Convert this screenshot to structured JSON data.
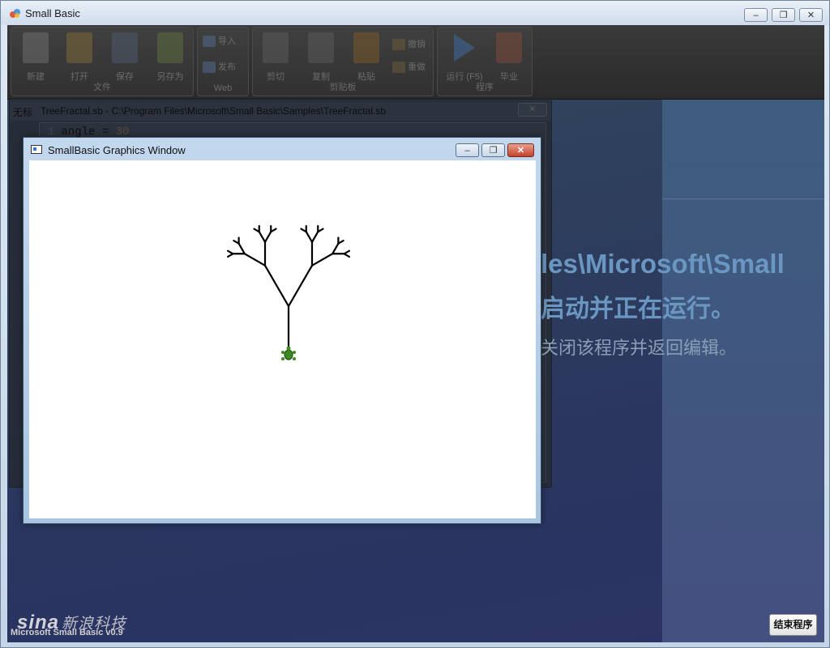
{
  "app": {
    "title": "Small Basic",
    "controls": {
      "minimize": "–",
      "restore": "❐",
      "close": "✕"
    }
  },
  "ribbon": {
    "groups": [
      {
        "label": "文件",
        "buttons": [
          "新建",
          "打开",
          "保存",
          "另存为"
        ]
      },
      {
        "label": "Web",
        "buttons": [
          "导入",
          "发布"
        ]
      },
      {
        "label": "剪贴板",
        "buttons": [
          "剪切",
          "复制",
          "粘贴",
          "撤销",
          "重做"
        ]
      },
      {
        "label": "程序",
        "buttons": [
          "运行 (F5)",
          "毕业"
        ]
      }
    ]
  },
  "editor": {
    "tab_untitled": "无标",
    "tab_file": "TreeFractal.sb - C:\\Program Files\\Microsoft\\Small Basic\\Samples\\TreeFractal.sb",
    "close_label": "✕",
    "code": {
      "line_number": "1",
      "text": "angle = ",
      "value": "30"
    }
  },
  "message": {
    "path_fragment": "les\\Microsoft\\Small",
    "running": "启动并正在运行。",
    "close_hint": "关闭该程序并返回编辑。"
  },
  "graphics_window": {
    "title": "SmallBasic Graphics Window",
    "controls": {
      "minimize": "–",
      "restore": "❐",
      "close": "✕"
    }
  },
  "status": {
    "version": "Microsoft Small Basic v0.9"
  },
  "watermark": {
    "brand": "sina",
    "text": "新浪科技"
  },
  "end_button": {
    "label": "结束程序"
  },
  "colors": {
    "turtle": "#3d8a22",
    "tree": "#000000",
    "accent": "#6a97c2"
  }
}
